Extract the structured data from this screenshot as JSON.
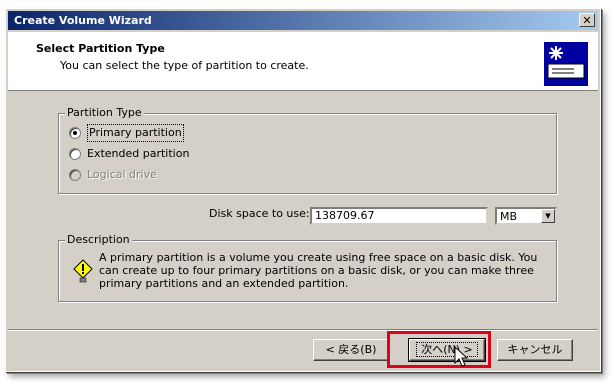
{
  "window": {
    "title": "Create Volume Wizard",
    "close_glyph": "✕"
  },
  "header": {
    "title": "Select Partition Type",
    "subtitle": "You can select the type of partition to create.",
    "icon": "disk-wizard-icon"
  },
  "partition_type": {
    "legend": "Partition Type",
    "options": [
      {
        "label": "Primary partition",
        "selected": true,
        "enabled": true
      },
      {
        "label": "Extended partition",
        "selected": false,
        "enabled": true
      },
      {
        "label": "Logical drive",
        "selected": false,
        "enabled": false
      }
    ]
  },
  "disk_space": {
    "label": "Disk space to use:",
    "value": "138709.67",
    "unit": "MB"
  },
  "description": {
    "legend": "Description",
    "text": "A primary partition is a volume you create using free space on a basic disk. You can create up to four primary partitions on a basic disk, or you can make three primary partitions and an extended partition.",
    "icon": "info-bulb-icon"
  },
  "buttons": {
    "back": "< 戻る(B)",
    "next": "次へ(N) >",
    "cancel": "キャンセル"
  },
  "colors": {
    "highlight": "#e0001a",
    "title_start": "#0a246a",
    "title_end": "#a6caf0",
    "face": "#d4d0c8"
  }
}
